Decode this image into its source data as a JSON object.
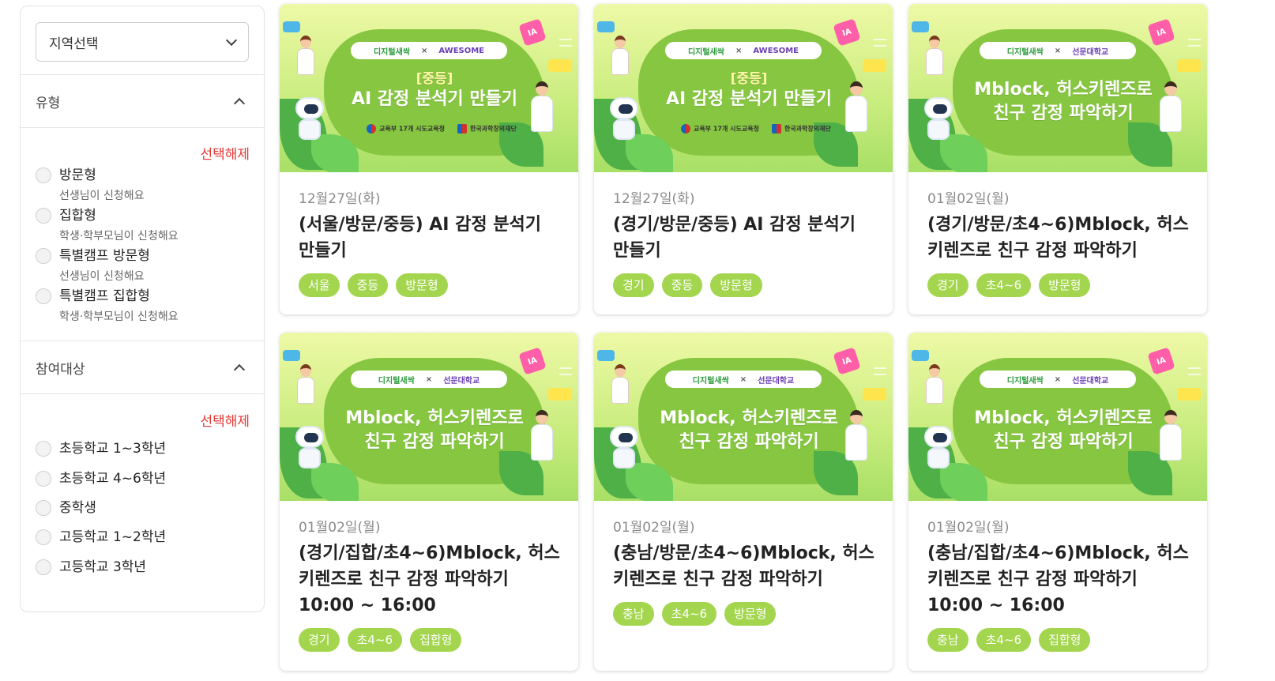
{
  "filters": {
    "region_select": {
      "label": "지역선택"
    },
    "type_section": {
      "title": "유형",
      "clear_label": "선택해제",
      "options": [
        {
          "label": "방문형",
          "sub": "선생님이 신청해요"
        },
        {
          "label": "집합형",
          "sub": "학생·학부모님이 신청해요"
        },
        {
          "label": "특별캠프 방문형",
          "sub": "선생님이 신청해요"
        },
        {
          "label": "특별캠프 집합형",
          "sub": "학생·학부모님이 신청해요"
        }
      ]
    },
    "target_section": {
      "title": "참여대상",
      "clear_label": "선택해제",
      "options": [
        {
          "label": "초등학교 1~3학년"
        },
        {
          "label": "초등학교 4~6학년"
        },
        {
          "label": "중학생"
        },
        {
          "label": "고등학교 1~2학년"
        },
        {
          "label": "고등학교 3학년"
        }
      ]
    }
  },
  "colors": {
    "accent_red": "#e53935",
    "tag_green": "#a3d64e",
    "banner_green": "#86c640"
  },
  "cards": [
    {
      "date": "12월27일(화)",
      "title": "(서울/방문/중등) AI 감정 분석기 만들기",
      "tags": [
        "서울",
        "중등",
        "방문형"
      ],
      "thumb": {
        "tag": "[중등]",
        "line1": "AI 감정 분석기 만들기",
        "line2": "",
        "partner_left": "디지털새싹",
        "partner_right": "AWESOME",
        "logo1": "교육부 17개 시도교육청",
        "logo2": "한국과학창의재단"
      }
    },
    {
      "date": "12월27일(화)",
      "title": "(경기/방문/중등) AI 감정 분석기 만들기",
      "tags": [
        "경기",
        "중등",
        "방문형"
      ],
      "thumb": {
        "tag": "[중등]",
        "line1": "AI 감정 분석기 만들기",
        "line2": "",
        "partner_left": "디지털새싹",
        "partner_right": "AWESOME",
        "logo1": "교육부 17개 시도교육청",
        "logo2": "한국과학창의재단"
      }
    },
    {
      "date": "01월02일(월)",
      "title": "(경기/방문/초4~6)Mblock, 허스키렌즈로 친구 감정 파악하기",
      "tags": [
        "경기",
        "초4~6",
        "방문형"
      ],
      "thumb": {
        "tag": "",
        "line1": "Mblock, 허스키렌즈로",
        "line2": "친구 감정 파악하기",
        "partner_left": "디지털새싹",
        "partner_right": "선문대학교",
        "logo1": "",
        "logo2": ""
      }
    },
    {
      "date": "01월02일(월)",
      "title": "(경기/집합/초4~6)Mblock, 허스키렌즈로 친구 감정 파악하기 10:00 ~ 16:00",
      "tags": [
        "경기",
        "초4~6",
        "집합형"
      ],
      "thumb": {
        "tag": "",
        "line1": "Mblock, 허스키렌즈로",
        "line2": "친구 감정 파악하기",
        "partner_left": "디지털새싹",
        "partner_right": "선문대학교",
        "logo1": "",
        "logo2": ""
      }
    },
    {
      "date": "01월02일(월)",
      "title": "(충남/방문/초4~6)Mblock, 허스키렌즈로 친구 감정 파악하기",
      "tags": [
        "충남",
        "초4~6",
        "방문형"
      ],
      "thumb": {
        "tag": "",
        "line1": "Mblock, 허스키렌즈로",
        "line2": "친구 감정 파악하기",
        "partner_left": "디지털새싹",
        "partner_right": "선문대학교",
        "logo1": "",
        "logo2": ""
      }
    },
    {
      "date": "01월02일(월)",
      "title": "(충남/집합/초4~6)Mblock, 허스키렌즈로 친구 감정 파악하기 10:00 ~ 16:00",
      "tags": [
        "충남",
        "초4~6",
        "집합형"
      ],
      "thumb": {
        "tag": "",
        "line1": "Mblock, 허스키렌즈로",
        "line2": "친구 감정 파악하기",
        "partner_left": "디지털새싹",
        "partner_right": "선문대학교",
        "logo1": "",
        "logo2": ""
      }
    }
  ]
}
